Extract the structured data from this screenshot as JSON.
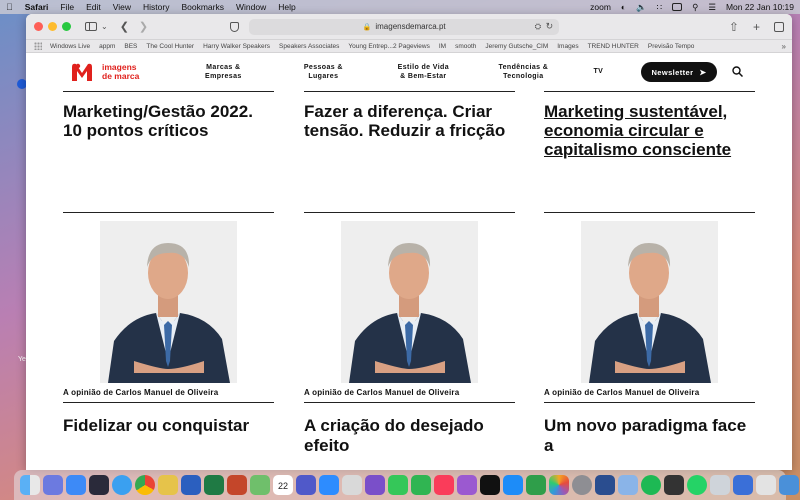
{
  "menubar": {
    "app": "Safari",
    "items": [
      "File",
      "Edit",
      "View",
      "History",
      "Bookmarks",
      "Window",
      "Help"
    ],
    "right_zoom": "zoom",
    "date_time": "Mon 22 Jan  10:19"
  },
  "browser": {
    "url": "imagensdemarca.pt",
    "favorites": [
      "Windows Live",
      "appm",
      "BES",
      "The Cool Hunter",
      "Harry Walker Speakers",
      "Speakers Associates",
      "Young Entrep...2 Pageviews",
      "IM",
      "smooth",
      "Jeremy Gutsche_CIM",
      "Images",
      "TREND HUNTER",
      "Previsão Tempo"
    ]
  },
  "site": {
    "logo_line1": "imagens",
    "logo_line2": "de marca",
    "brand_color": "#e0211d",
    "nav": [
      {
        "line1": "Marcas &",
        "line2": "Empresas"
      },
      {
        "line1": "Pessoas &",
        "line2": "Lugares"
      },
      {
        "line1": "Estilo de Vida",
        "line2": "& Bem-Estar"
      },
      {
        "line1": "Tendências &",
        "line2": "Tecnologia"
      },
      {
        "line1": "TV",
        "line2": ""
      }
    ],
    "newsletter_label": "Newsletter"
  },
  "articles_top": [
    {
      "title": "Marketing/Gestão 2022. 10 pontos críticos"
    },
    {
      "title": "Fazer a diferença. Criar tensão. Reduzir a fricção"
    },
    {
      "title": "Marketing sustentável, economia circular e capitalismo consciente"
    }
  ],
  "articles_bottom": [
    {
      "kicker": "A opinião de Carlos Manuel de Oliveira",
      "title": "Fidelizar ou conquistar"
    },
    {
      "kicker": "A opinião de Carlos Manuel de Oliveira",
      "title": "A criação do desejado efeito"
    },
    {
      "kicker": "A opinião de Carlos Manuel de Oliveira",
      "title": "Um novo paradigma face a"
    }
  ],
  "desktop": {
    "left_label_y": "Ye"
  },
  "dock": {
    "icons": [
      "finder-icon",
      "launchpad-icon",
      "mail-icon",
      "photos-icon",
      "safari-icon",
      "chrome-icon",
      "notes-icon",
      "word-icon",
      "excel-icon",
      "powerpoint-icon",
      "maps-icon",
      "calendar-icon",
      "teams-icon",
      "zoom-icon",
      "preview-icon",
      "imovie-icon",
      "messages-icon",
      "facetime-icon",
      "music-icon",
      "podcasts-icon",
      "appletv-icon",
      "appstore-icon",
      "numbers-icon",
      "photos2-icon",
      "settings-icon",
      "lightroom-icon",
      "folder-icon",
      "spotify-icon",
      "terminal-icon",
      "whatsapp-icon",
      "help-icon",
      "vpn-icon",
      "screen-icon",
      "finder2-icon",
      "trash-icon"
    ],
    "calendar_day": "22"
  }
}
